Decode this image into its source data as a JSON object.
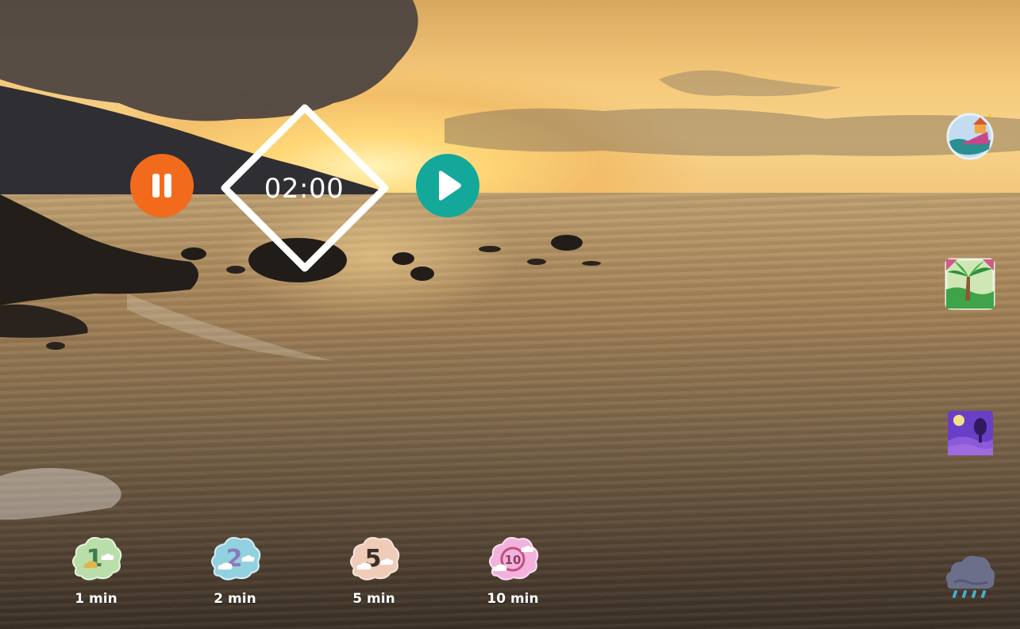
{
  "timer": {
    "display": "02:00"
  },
  "controls": {
    "pause_icon": "pause-icon",
    "play_icon": "play-icon",
    "pause_color": "#f26b1d",
    "play_color": "#13a89a"
  },
  "presets": [
    {
      "label": "1 min",
      "icon": "one-minute-cloud-icon",
      "color": "#b4dca6"
    },
    {
      "label": "2 min",
      "icon": "two-minute-cloud-icon",
      "color": "#8fd0df"
    },
    {
      "label": "5 min",
      "icon": "five-minute-cloud-icon",
      "color": "#f2c9b4"
    },
    {
      "label": "10 min",
      "icon": "ten-minute-cloud-icon",
      "color": "#f2b0dc"
    }
  ],
  "sidebar": [
    {
      "icon": "beach-house-scene-icon"
    },
    {
      "icon": "jungle-scene-icon"
    },
    {
      "icon": "night-scene-icon"
    },
    {
      "icon": "rain-cloud-scene-icon"
    }
  ]
}
